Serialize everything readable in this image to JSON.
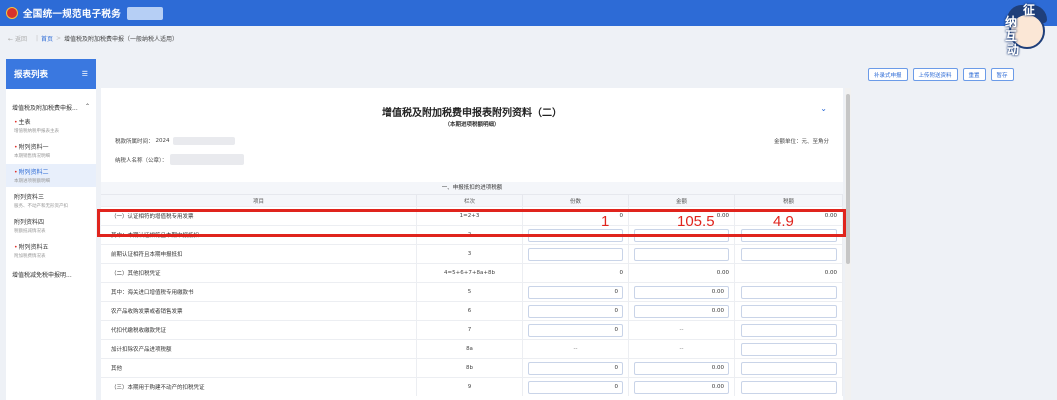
{
  "app": {
    "title": "全国统一规范电子税务",
    "mascot": [
      "征",
      "纳",
      "互",
      "动"
    ]
  },
  "breadcrumb": {
    "back": "返回",
    "home": "首页",
    "current": "增值税及附加税费申报（一般纳税人适用）"
  },
  "sidebar": {
    "title": "报表列表",
    "group": "增值税及附加税费申报...",
    "items": [
      {
        "label": "主表",
        "sub": "增值税纳税申报表主表"
      },
      {
        "label": "附列资料一",
        "sub": "本期销售情况明细"
      },
      {
        "label": "附列资料二",
        "sub": "本期进项税额明细"
      },
      {
        "label": "附列资料三",
        "sub": "服务、不动产和无形资产扣"
      },
      {
        "label": "附列资料四",
        "sub": "税额抵减情况表"
      },
      {
        "label": "附列资料五",
        "sub": "附加税费情况表"
      }
    ],
    "last": "增值税减免税申报明..."
  },
  "actions": [
    "补录式申报",
    "上传附送资料",
    "重置",
    "暂存"
  ],
  "form": {
    "title": "增值税及附加税费申报表附列资料（二）",
    "subtitle": "（本期进项税额明细）",
    "period_label": "税款所属时间：",
    "period_value": "2024",
    "taxpayer_label": "纳税人名称（公章）：",
    "unit": "金额单位：元、至角分",
    "section": "一、申报抵扣的进项税额",
    "headers": [
      "项目",
      "栏次",
      "份数",
      "金额",
      "税额"
    ]
  },
  "rows": [
    {
      "item": "（一）认证相符的增值税专用发票",
      "col": "1=2+3",
      "count": "0",
      "amount": "0.00",
      "tax": "0.00"
    },
    {
      "item": "其中：本期认证相符且本期申报抵扣",
      "col": "2",
      "count": "",
      "amount": "",
      "tax": ""
    },
    {
      "item": "前期认证相符且本期申报抵扣",
      "col": "3",
      "count": "",
      "amount": "",
      "tax": ""
    },
    {
      "item": "（二）其他扣税凭证",
      "col": "4=5+6+7+8a+8b",
      "count": "0",
      "amount": "0.00",
      "tax": "0.00"
    },
    {
      "item": "其中：海关进口增值税专用缴款书",
      "col": "5",
      "count": "0",
      "amount": "0.00",
      "tax": ""
    },
    {
      "item": "农产品收购发票或者销售发票",
      "col": "6",
      "count": "0",
      "amount": "0.00",
      "tax": ""
    },
    {
      "item": "代扣代缴税收缴款凭证",
      "col": "7",
      "count": "0",
      "amount": "--",
      "tax": ""
    },
    {
      "item": "加计扣除农产品进项税额",
      "col": "8a",
      "count": "--",
      "amount": "--",
      "tax": ""
    },
    {
      "item": "其他",
      "col": "8b",
      "count": "0",
      "amount": "0.00",
      "tax": ""
    },
    {
      "item": "（三）本期用于购建不动产的扣税凭证",
      "col": "9",
      "count": "0",
      "amount": "0.00",
      "tax": ""
    }
  ],
  "overlay": {
    "count": "1",
    "amount": "105.5",
    "tax": "4.9"
  },
  "colors": {
    "header_blue": "#2d6bd6",
    "highlight_red": "#e0241d"
  }
}
